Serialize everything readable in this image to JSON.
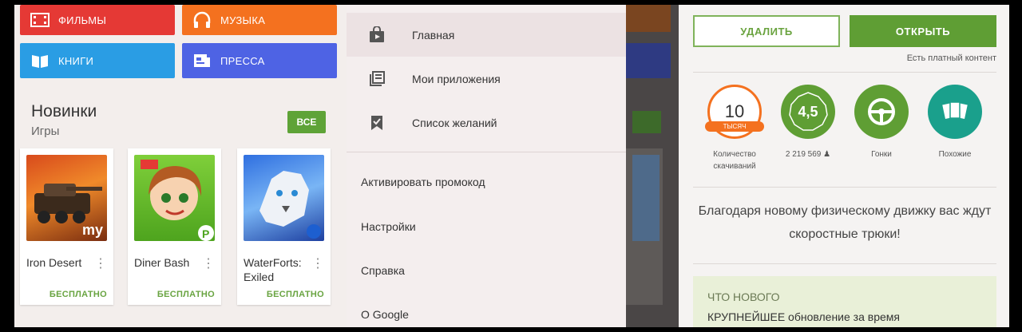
{
  "categories": {
    "films": "ФИЛЬМЫ",
    "music": "МУЗЫКА",
    "books": "КНИГИ",
    "press": "ПРЕССА"
  },
  "new_section": {
    "title": "Новинки",
    "subtitle": "Игры",
    "all_label": "ВСЕ"
  },
  "apps": [
    {
      "name": "Iron Desert",
      "price": "БЕСПЛАТНО"
    },
    {
      "name": "Diner Bash",
      "price": "БЕСПЛАТНО"
    },
    {
      "name": "WaterForts: Exiled",
      "price": "БЕСПЛАТНО"
    }
  ],
  "drawer": {
    "items": [
      {
        "label": "Главная",
        "icon": "store-icon"
      },
      {
        "label": "Мои приложения",
        "icon": "my-apps-icon"
      },
      {
        "label": "Список желаний",
        "icon": "bookmark-icon"
      }
    ],
    "plain_items": [
      "Активировать промокод",
      "Настройки",
      "Справка",
      "О Google"
    ]
  },
  "details": {
    "delete_label": "УДАЛИТЬ",
    "open_label": "ОТКРЫТЬ",
    "ingame_note": "Есть платный контент",
    "stats": [
      {
        "value": "10",
        "sub": "ТЫСЯЧ",
        "label": "Количество скачиваний"
      },
      {
        "value": "4,5",
        "sub": "",
        "label": "2 219 569 ♟"
      },
      {
        "value": "",
        "sub": "",
        "label": "Гонки"
      },
      {
        "value": "",
        "sub": "",
        "label": "Похожие"
      }
    ],
    "description": "Благодаря новому физическому движку вас ждут скоростные трюки!",
    "whats_new_title": "ЧТО НОВОГО",
    "whats_new_text": "КРУПНЕЙШЕЕ обновление за время"
  },
  "colors": {
    "films": "#e53935",
    "music": "#f4711f",
    "books": "#2a9de4",
    "press": "#4e63e4",
    "green": "#5f9e34",
    "orange": "#f4711f"
  }
}
